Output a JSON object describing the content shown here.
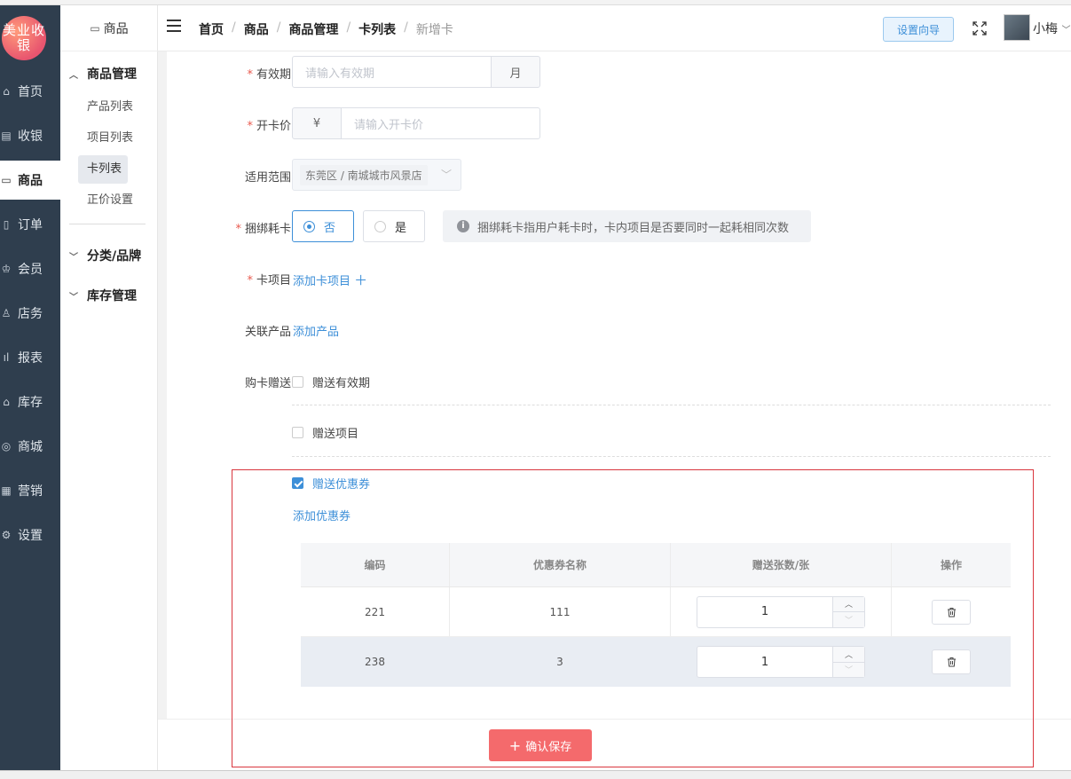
{
  "sidebar": {
    "logo": "美业收银",
    "items": [
      {
        "label": "首页",
        "icon": "home-icon"
      },
      {
        "label": "收银",
        "icon": "cashier-icon"
      },
      {
        "label": "商品",
        "icon": "goods-icon",
        "active": true
      },
      {
        "label": "订单",
        "icon": "order-icon"
      },
      {
        "label": "会员",
        "icon": "member-icon"
      },
      {
        "label": "店务",
        "icon": "store-icon"
      },
      {
        "label": "报表",
        "icon": "report-icon"
      },
      {
        "label": "库存",
        "icon": "warehouse-icon"
      },
      {
        "label": "商城",
        "icon": "mall-icon"
      },
      {
        "label": "营销",
        "icon": "gift-icon"
      },
      {
        "label": "设置",
        "icon": "gear-icon"
      }
    ]
  },
  "submenu": {
    "title": "商品",
    "group1": "商品管理",
    "items": [
      "产品列表",
      "项目列表",
      "卡列表",
      "正价设置"
    ],
    "group2": "分类/品牌",
    "group3": "库存管理"
  },
  "header": {
    "breadcrumb": [
      "首页",
      "商品",
      "商品管理",
      "卡列表",
      "新增卡"
    ],
    "setup_label": "设置向导",
    "username": "小梅"
  },
  "form": {
    "validity": {
      "label": "有效期",
      "placeholder": "请输入有效期",
      "unit": "月"
    },
    "price": {
      "label": "开卡价",
      "prefix": "¥",
      "placeholder": "请输入开卡价"
    },
    "scope": {
      "label": "适用范围",
      "value": "东莞区 / 南城城市风景店"
    },
    "bind": {
      "label": "捆绑耗卡",
      "option_no": "否",
      "option_yes": "是",
      "hint": "捆绑耗卡指用户耗卡时，卡内项目是否要同时一起耗相同次数"
    },
    "card_items": {
      "label": "卡项目",
      "link": "添加卡项目"
    },
    "products": {
      "label": "关联产品",
      "link": "添加产品"
    },
    "gift": {
      "label": "购卡赠送",
      "opt_validity": "赠送有效期",
      "opt_items": "赠送项目",
      "opt_coupon": "赠送优惠券",
      "add_coupon": "添加优惠券"
    }
  },
  "coupon_table": {
    "headers": [
      "编码",
      "优惠券名称",
      "赠送张数/张",
      "操作"
    ],
    "rows": [
      {
        "code": "221",
        "name": "111",
        "qty": "1"
      },
      {
        "code": "238",
        "name": "3",
        "qty": "1"
      }
    ]
  },
  "footer": {
    "save_label": "确认保存"
  },
  "colors": {
    "accent": "#3d8fd8",
    "sidebar": "#2f3e4e",
    "save": "#f46a6c",
    "required": "#e95a4f"
  }
}
